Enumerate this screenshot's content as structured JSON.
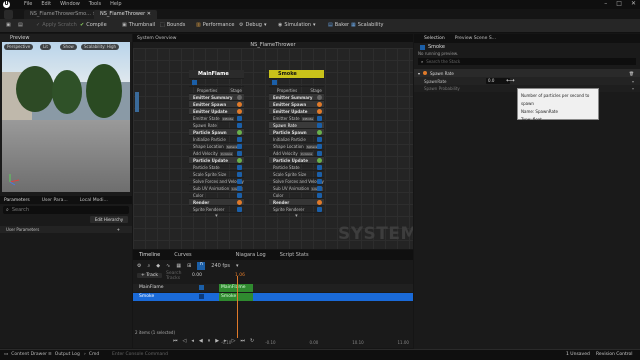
{
  "titlebar": {
    "menu": [
      "File",
      "Edit",
      "Window",
      "Tools",
      "Help"
    ]
  },
  "tabs": [
    "NS_FlameThrowerSmo...",
    "NS_FlameThrower"
  ],
  "toolbar": {
    "items": [
      "Apply Scratch",
      "Compile",
      "Thumbnail",
      "Bounds",
      "Performance",
      "Debug",
      "Simulation",
      "Baker",
      "Scalability"
    ]
  },
  "preview": {
    "title": "Preview",
    "pills": [
      "Perspective",
      "Lit",
      "Show",
      "Scalability: High"
    ]
  },
  "params": {
    "tabs": [
      "Parameters",
      "User Para...",
      "Local Modi..."
    ],
    "search_placeholder": "Search",
    "edit_hierarchy": "Edit Hierarchy",
    "user_parameters": "User Parameters"
  },
  "sysov": {
    "tab": "System Overview",
    "title": "NS_FlameThrower",
    "watermark": "SYSTEM"
  },
  "node1": {
    "title": "MainFlame",
    "properties": "Properties",
    "stage": "Stage",
    "rows": [
      "Emitter Summary",
      "Emitter Spawn",
      "Emitter Update",
      "Emitter State",
      "Spawn Rate",
      "Particle Spawn",
      "Initialize Particle",
      "Shape Location",
      "Add Velocity",
      "Particle Update",
      "Particle State",
      "Scale Sprite Size",
      "Solve Forces and Velocity",
      "Sub UV Animation",
      "Color",
      "Render",
      "Sprite Renderer"
    ],
    "tags": {
      "3": "Infinite",
      "7": "Sphere",
      "8": "In Cone",
      "13": "Linear"
    }
  },
  "node2": {
    "title": "Smoke",
    "properties": "Properties",
    "stage": "Stage",
    "rows": [
      "Emitter Summary",
      "Emitter Spawn",
      "Emitter Update",
      "Emitter State",
      "Spawn Rate",
      "Particle Spawn",
      "Initialize Particle",
      "Shape Location",
      "Add Velocity",
      "Particle Update",
      "Particle State",
      "Scale Sprite Size",
      "Solve Forces and Velocity",
      "Sub UV Animation",
      "Color",
      "Render",
      "Sprite Renderer"
    ],
    "tags": {
      "3": "Infinite",
      "7": "Sphere",
      "8": "In Cone",
      "13": "Linear"
    }
  },
  "selection": {
    "tabs": [
      "Selection",
      "Preview Scene S..."
    ],
    "emitter": "Smoke",
    "status": "No running preview.",
    "search_placeholder": "Search the Stack",
    "section": "Spawn Rate",
    "prop1": "SpawnRate",
    "prop1_value": "0.0",
    "prop2": "Spawn Probability",
    "tooltip": [
      "Number of particles per second to spawn",
      "Name: SpawnRate",
      "Type: float"
    ]
  },
  "timeline": {
    "tabs": [
      "Timeline",
      "Curves",
      "Niagara Log",
      "Script Stats"
    ],
    "track_btn": "+ Track",
    "search_placeholder": "Search Tracks",
    "fps": "240 fps",
    "time": "0.00",
    "playhead": "1.06",
    "tracks": [
      "MainFlame",
      "Smoke"
    ],
    "status": "2 items (1 selected)",
    "ruler": [
      "-0.10",
      "-0.10",
      "0.00",
      "10.10",
      "11.00"
    ]
  },
  "statusbar": {
    "items": [
      "Content Drawer",
      "Output Log",
      "Cmd"
    ],
    "console_placeholder": "Enter Console Command",
    "right": [
      "1 Unsaved",
      "Revision Control"
    ]
  }
}
